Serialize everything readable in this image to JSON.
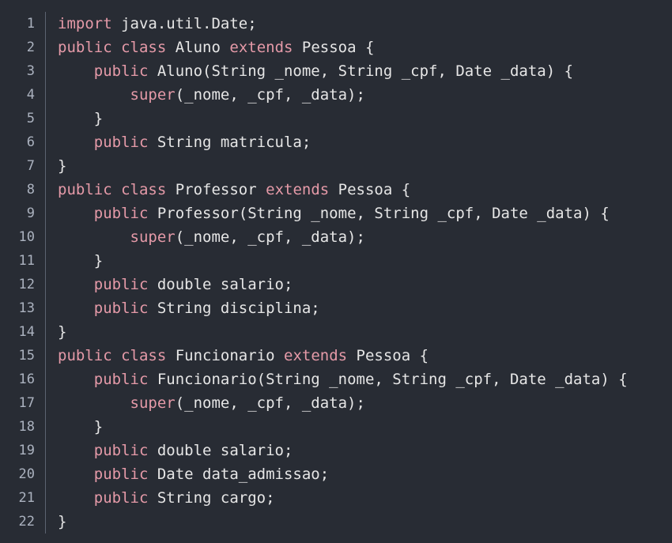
{
  "editor": {
    "background": "#282c34",
    "keyword_color": "#e59aa8",
    "text_color": "#e6e6e6",
    "line_number_color": "#abb2bf",
    "lines": [
      {
        "n": "1",
        "indent": "",
        "tokens": [
          {
            "t": "import",
            "c": "kw"
          },
          {
            "t": " java.util.Date;",
            "c": "pl"
          }
        ]
      },
      {
        "n": "2",
        "indent": "",
        "tokens": [
          {
            "t": "public",
            "c": "kw"
          },
          {
            "t": " ",
            "c": "pl"
          },
          {
            "t": "class",
            "c": "kw"
          },
          {
            "t": " Aluno ",
            "c": "pl"
          },
          {
            "t": "extends",
            "c": "kw"
          },
          {
            "t": " Pessoa {",
            "c": "pl"
          }
        ]
      },
      {
        "n": "3",
        "indent": "    ",
        "tokens": [
          {
            "t": "public",
            "c": "kw"
          },
          {
            "t": " Aluno(String _nome, String _cpf, Date _data) {",
            "c": "pl"
          }
        ]
      },
      {
        "n": "4",
        "indent": "        ",
        "tokens": [
          {
            "t": "super",
            "c": "kw"
          },
          {
            "t": "(_nome, _cpf, _data);",
            "c": "pl"
          }
        ]
      },
      {
        "n": "5",
        "indent": "    ",
        "tokens": [
          {
            "t": "}",
            "c": "pl"
          }
        ]
      },
      {
        "n": "6",
        "indent": "    ",
        "tokens": [
          {
            "t": "public",
            "c": "kw"
          },
          {
            "t": " String matricula;",
            "c": "pl"
          }
        ]
      },
      {
        "n": "7",
        "indent": "",
        "tokens": [
          {
            "t": "}",
            "c": "pl"
          }
        ]
      },
      {
        "n": "8",
        "indent": "",
        "tokens": [
          {
            "t": "public",
            "c": "kw"
          },
          {
            "t": " ",
            "c": "pl"
          },
          {
            "t": "class",
            "c": "kw"
          },
          {
            "t": " Professor ",
            "c": "pl"
          },
          {
            "t": "extends",
            "c": "kw"
          },
          {
            "t": " Pessoa {",
            "c": "pl"
          }
        ]
      },
      {
        "n": "9",
        "indent": "    ",
        "tokens": [
          {
            "t": "public",
            "c": "kw"
          },
          {
            "t": " Professor(String _nome, String _cpf, Date _data) {",
            "c": "pl"
          }
        ]
      },
      {
        "n": "10",
        "indent": "        ",
        "tokens": [
          {
            "t": "super",
            "c": "kw"
          },
          {
            "t": "(_nome, _cpf, _data);",
            "c": "pl"
          }
        ]
      },
      {
        "n": "11",
        "indent": "    ",
        "tokens": [
          {
            "t": "}",
            "c": "pl"
          }
        ]
      },
      {
        "n": "12",
        "indent": "    ",
        "tokens": [
          {
            "t": "public",
            "c": "kw"
          },
          {
            "t": " double salario;",
            "c": "pl"
          }
        ]
      },
      {
        "n": "13",
        "indent": "    ",
        "tokens": [
          {
            "t": "public",
            "c": "kw"
          },
          {
            "t": " String disciplina;",
            "c": "pl"
          }
        ]
      },
      {
        "n": "14",
        "indent": "",
        "tokens": [
          {
            "t": "}",
            "c": "pl"
          }
        ]
      },
      {
        "n": "15",
        "indent": "",
        "tokens": [
          {
            "t": "public",
            "c": "kw"
          },
          {
            "t": " ",
            "c": "pl"
          },
          {
            "t": "class",
            "c": "kw"
          },
          {
            "t": " Funcionario ",
            "c": "pl"
          },
          {
            "t": "extends",
            "c": "kw"
          },
          {
            "t": " Pessoa {",
            "c": "pl"
          }
        ]
      },
      {
        "n": "16",
        "indent": "    ",
        "tokens": [
          {
            "t": "public",
            "c": "kw"
          },
          {
            "t": " Funcionario(String _nome, String _cpf, Date _data) {",
            "c": "pl"
          }
        ]
      },
      {
        "n": "17",
        "indent": "        ",
        "tokens": [
          {
            "t": "super",
            "c": "kw"
          },
          {
            "t": "(_nome, _cpf, _data);",
            "c": "pl"
          }
        ]
      },
      {
        "n": "18",
        "indent": "    ",
        "tokens": [
          {
            "t": "}",
            "c": "pl"
          }
        ]
      },
      {
        "n": "19",
        "indent": "    ",
        "tokens": [
          {
            "t": "public",
            "c": "kw"
          },
          {
            "t": " double salario;",
            "c": "pl"
          }
        ]
      },
      {
        "n": "20",
        "indent": "    ",
        "tokens": [
          {
            "t": "public",
            "c": "kw"
          },
          {
            "t": " Date data_admissao;",
            "c": "pl"
          }
        ]
      },
      {
        "n": "21",
        "indent": "    ",
        "tokens": [
          {
            "t": "public",
            "c": "kw"
          },
          {
            "t": " String cargo;",
            "c": "pl"
          }
        ]
      },
      {
        "n": "22",
        "indent": "",
        "tokens": [
          {
            "t": "}",
            "c": "pl"
          }
        ]
      }
    ]
  }
}
